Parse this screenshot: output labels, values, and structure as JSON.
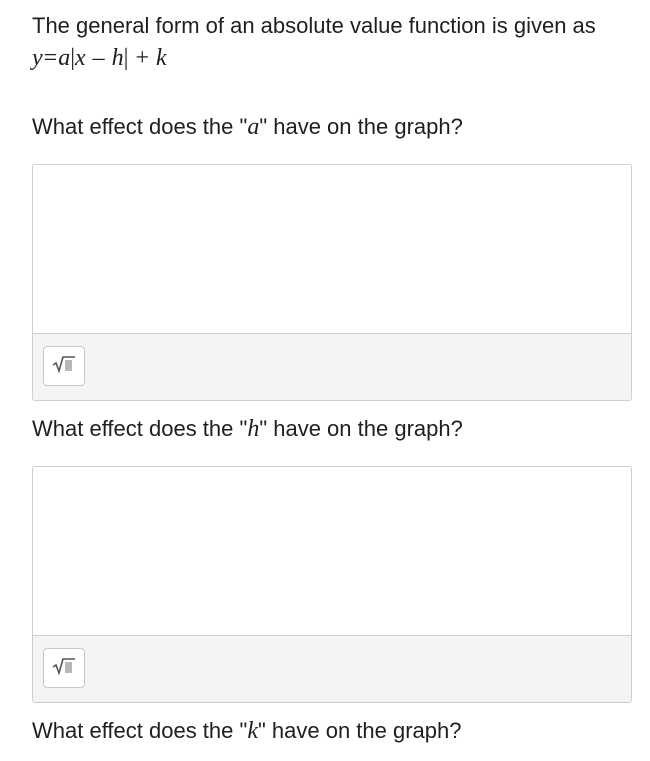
{
  "intro": {
    "text": "The general form of an absolute value function is given as",
    "equation": {
      "y": "y",
      "eq": "=",
      "a": "a",
      "bar_left": "|",
      "x": "x",
      "minus": "–",
      "h": "h",
      "bar_right": "|",
      "plus": "+",
      "k": "k"
    }
  },
  "questions": [
    {
      "prefix": "What effect does the \"",
      "var": "a",
      "suffix": "\" have on the graph?"
    },
    {
      "prefix": "What effect does the \"",
      "var": "h",
      "suffix": "\" have on the graph?"
    },
    {
      "prefix": "What effect does the \"",
      "var": "k",
      "suffix": "\" have on the graph?"
    }
  ],
  "answers": [
    {
      "value": "",
      "math_button_icon": "square-root-icon"
    },
    {
      "value": "",
      "math_button_icon": "square-root-icon"
    }
  ]
}
